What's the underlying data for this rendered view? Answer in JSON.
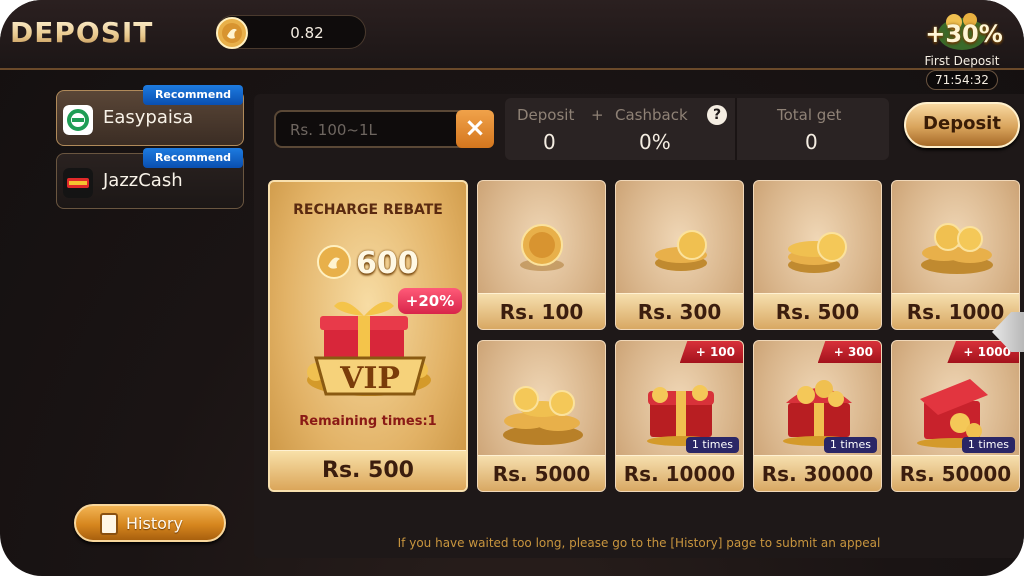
{
  "header": {
    "title": "DEPOSIT",
    "balance": "0.82"
  },
  "promo": {
    "percent": "+30%",
    "label": "First Deposit",
    "timer": "71:54:32"
  },
  "methods": [
    {
      "name": "Easypaisa",
      "tag": "Recommend",
      "selected": true
    },
    {
      "name": "JazzCash",
      "tag": "Recommend",
      "selected": false
    }
  ],
  "history_button": "History",
  "amount_input": {
    "placeholder": "Rs.   100~1L"
  },
  "summary": {
    "deposit_label": "Deposit",
    "plus": "+",
    "cashback_label": "Cashback",
    "help": "?",
    "total_label": "Total get",
    "deposit_value": "0",
    "cashback_value": "0%",
    "total_value": "0"
  },
  "deposit_button": "Deposit",
  "vip_card": {
    "title": "RECHARGE REBATE",
    "coins": "600",
    "percent": "+20%",
    "vip_text": "VIP",
    "remaining": "Remaining times:1",
    "price": "Rs. 500"
  },
  "packages": [
    {
      "price": "Rs. 100",
      "bonus": "",
      "times": ""
    },
    {
      "price": "Rs. 300",
      "bonus": "",
      "times": ""
    },
    {
      "price": "Rs. 500",
      "bonus": "",
      "times": ""
    },
    {
      "price": "Rs. 1000",
      "bonus": "",
      "times": ""
    },
    {
      "price": "Rs. 5000",
      "bonus": "",
      "times": ""
    },
    {
      "price": "Rs. 10000",
      "bonus": "+ 100",
      "times": "1 times"
    },
    {
      "price": "Rs. 30000",
      "bonus": "+ 300",
      "times": "1 times"
    },
    {
      "price": "Rs. 50000",
      "bonus": "+ 1000",
      "times": "1 times"
    }
  ],
  "footer_note": "If you have waited too long, please go to the [History] page to submit an appeal",
  "colors": {
    "accent_gold": "#d9a45c",
    "recommend_blue": "#1e7be0",
    "bonus_red": "#d8313a"
  }
}
